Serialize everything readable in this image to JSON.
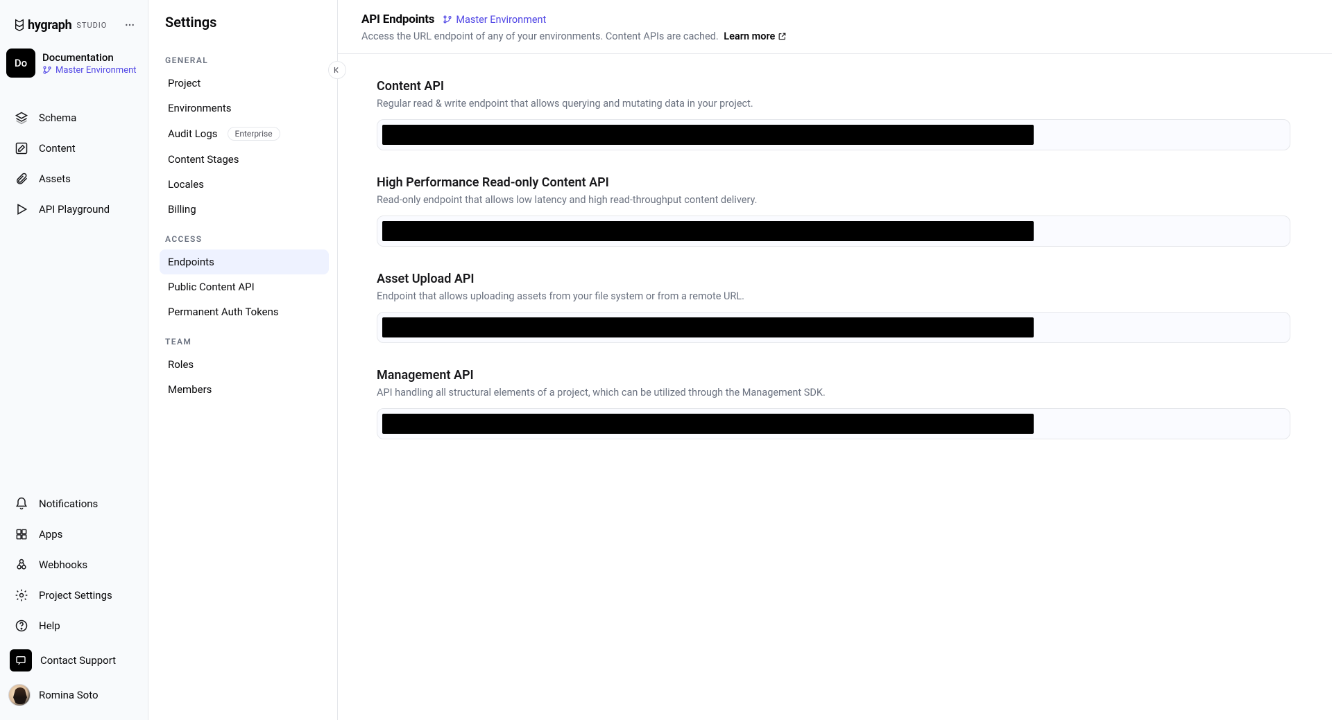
{
  "brand": {
    "name": "hygraph",
    "suffix": "STUDIO"
  },
  "project": {
    "short": "Do",
    "name": "Documentation",
    "environment": "Master Environment"
  },
  "primary_nav": {
    "top": [
      {
        "id": "schema",
        "label": "Schema",
        "icon": "layers-icon"
      },
      {
        "id": "content",
        "label": "Content",
        "icon": "pencil-square-icon"
      },
      {
        "id": "assets",
        "label": "Assets",
        "icon": "paperclip-icon"
      },
      {
        "id": "api-playground",
        "label": "API Playground",
        "icon": "play-icon"
      }
    ],
    "bottom": [
      {
        "id": "notifications",
        "label": "Notifications",
        "icon": "bell-icon"
      },
      {
        "id": "apps",
        "label": "Apps",
        "icon": "grid-icon"
      },
      {
        "id": "webhooks",
        "label": "Webhooks",
        "icon": "webhook-icon"
      },
      {
        "id": "project-settings",
        "label": "Project Settings",
        "icon": "gear-icon"
      },
      {
        "id": "help",
        "label": "Help",
        "icon": "question-icon"
      }
    ],
    "support_label": "Contact Support"
  },
  "user": {
    "name": "Romina Soto"
  },
  "settings": {
    "title": "Settings",
    "groups": [
      {
        "label": "GENERAL",
        "items": [
          {
            "id": "project",
            "label": "Project"
          },
          {
            "id": "environments",
            "label": "Environments"
          },
          {
            "id": "audit-logs",
            "label": "Audit Logs",
            "badge": "Enterprise"
          },
          {
            "id": "content-stages",
            "label": "Content Stages"
          },
          {
            "id": "locales",
            "label": "Locales"
          },
          {
            "id": "billing",
            "label": "Billing"
          }
        ]
      },
      {
        "label": "ACCESS",
        "items": [
          {
            "id": "endpoints",
            "label": "Endpoints",
            "active": true
          },
          {
            "id": "public-content-api",
            "label": "Public Content API"
          },
          {
            "id": "permanent-auth-tokens",
            "label": "Permanent Auth Tokens"
          }
        ]
      },
      {
        "label": "TEAM",
        "items": [
          {
            "id": "roles",
            "label": "Roles"
          },
          {
            "id": "members",
            "label": "Members"
          }
        ]
      }
    ]
  },
  "page": {
    "title": "API Endpoints",
    "environment": "Master Environment",
    "subtitle": "Access the URL endpoint of any of your environments. Content APIs are cached.",
    "learn_more": "Learn more",
    "sections": [
      {
        "id": "content-api",
        "title": "Content API",
        "desc": "Regular read & write endpoint that allows querying and mutating data in your project."
      },
      {
        "id": "hp-readonly-api",
        "title": "High Performance Read-only Content API",
        "desc": "Read-only endpoint that allows low latency and high read-throughput content delivery."
      },
      {
        "id": "asset-upload-api",
        "title": "Asset Upload API",
        "desc": "Endpoint that allows uploading assets from your file system or from a remote URL."
      },
      {
        "id": "management-api",
        "title": "Management API",
        "desc": "API handling all structural elements of a project, which can be utilized through the Management SDK."
      }
    ]
  }
}
